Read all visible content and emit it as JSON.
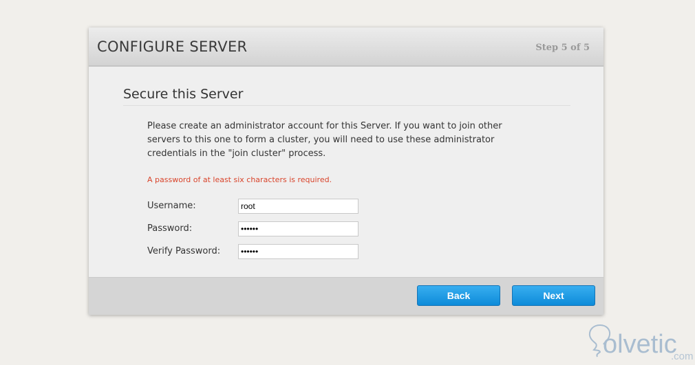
{
  "header": {
    "title": "CONFIGURE SERVER",
    "step": "Step 5 of 5"
  },
  "section": {
    "title": "Secure this Server",
    "description": "Please create an administrator account for this Server. If you want to join other servers to this one to form a cluster, you will need to use these administrator credentials in the \"join cluster\" process.",
    "error": "A password of at least six characters is required."
  },
  "form": {
    "username": {
      "label": "Username:",
      "value": "root"
    },
    "password": {
      "label": "Password:",
      "value": "123456"
    },
    "verify": {
      "label": "Verify Password:",
      "value": "123456"
    }
  },
  "footer": {
    "back": "Back",
    "next": "Next"
  },
  "watermark": {
    "brand": "olvetic",
    "suffix": ".com"
  }
}
